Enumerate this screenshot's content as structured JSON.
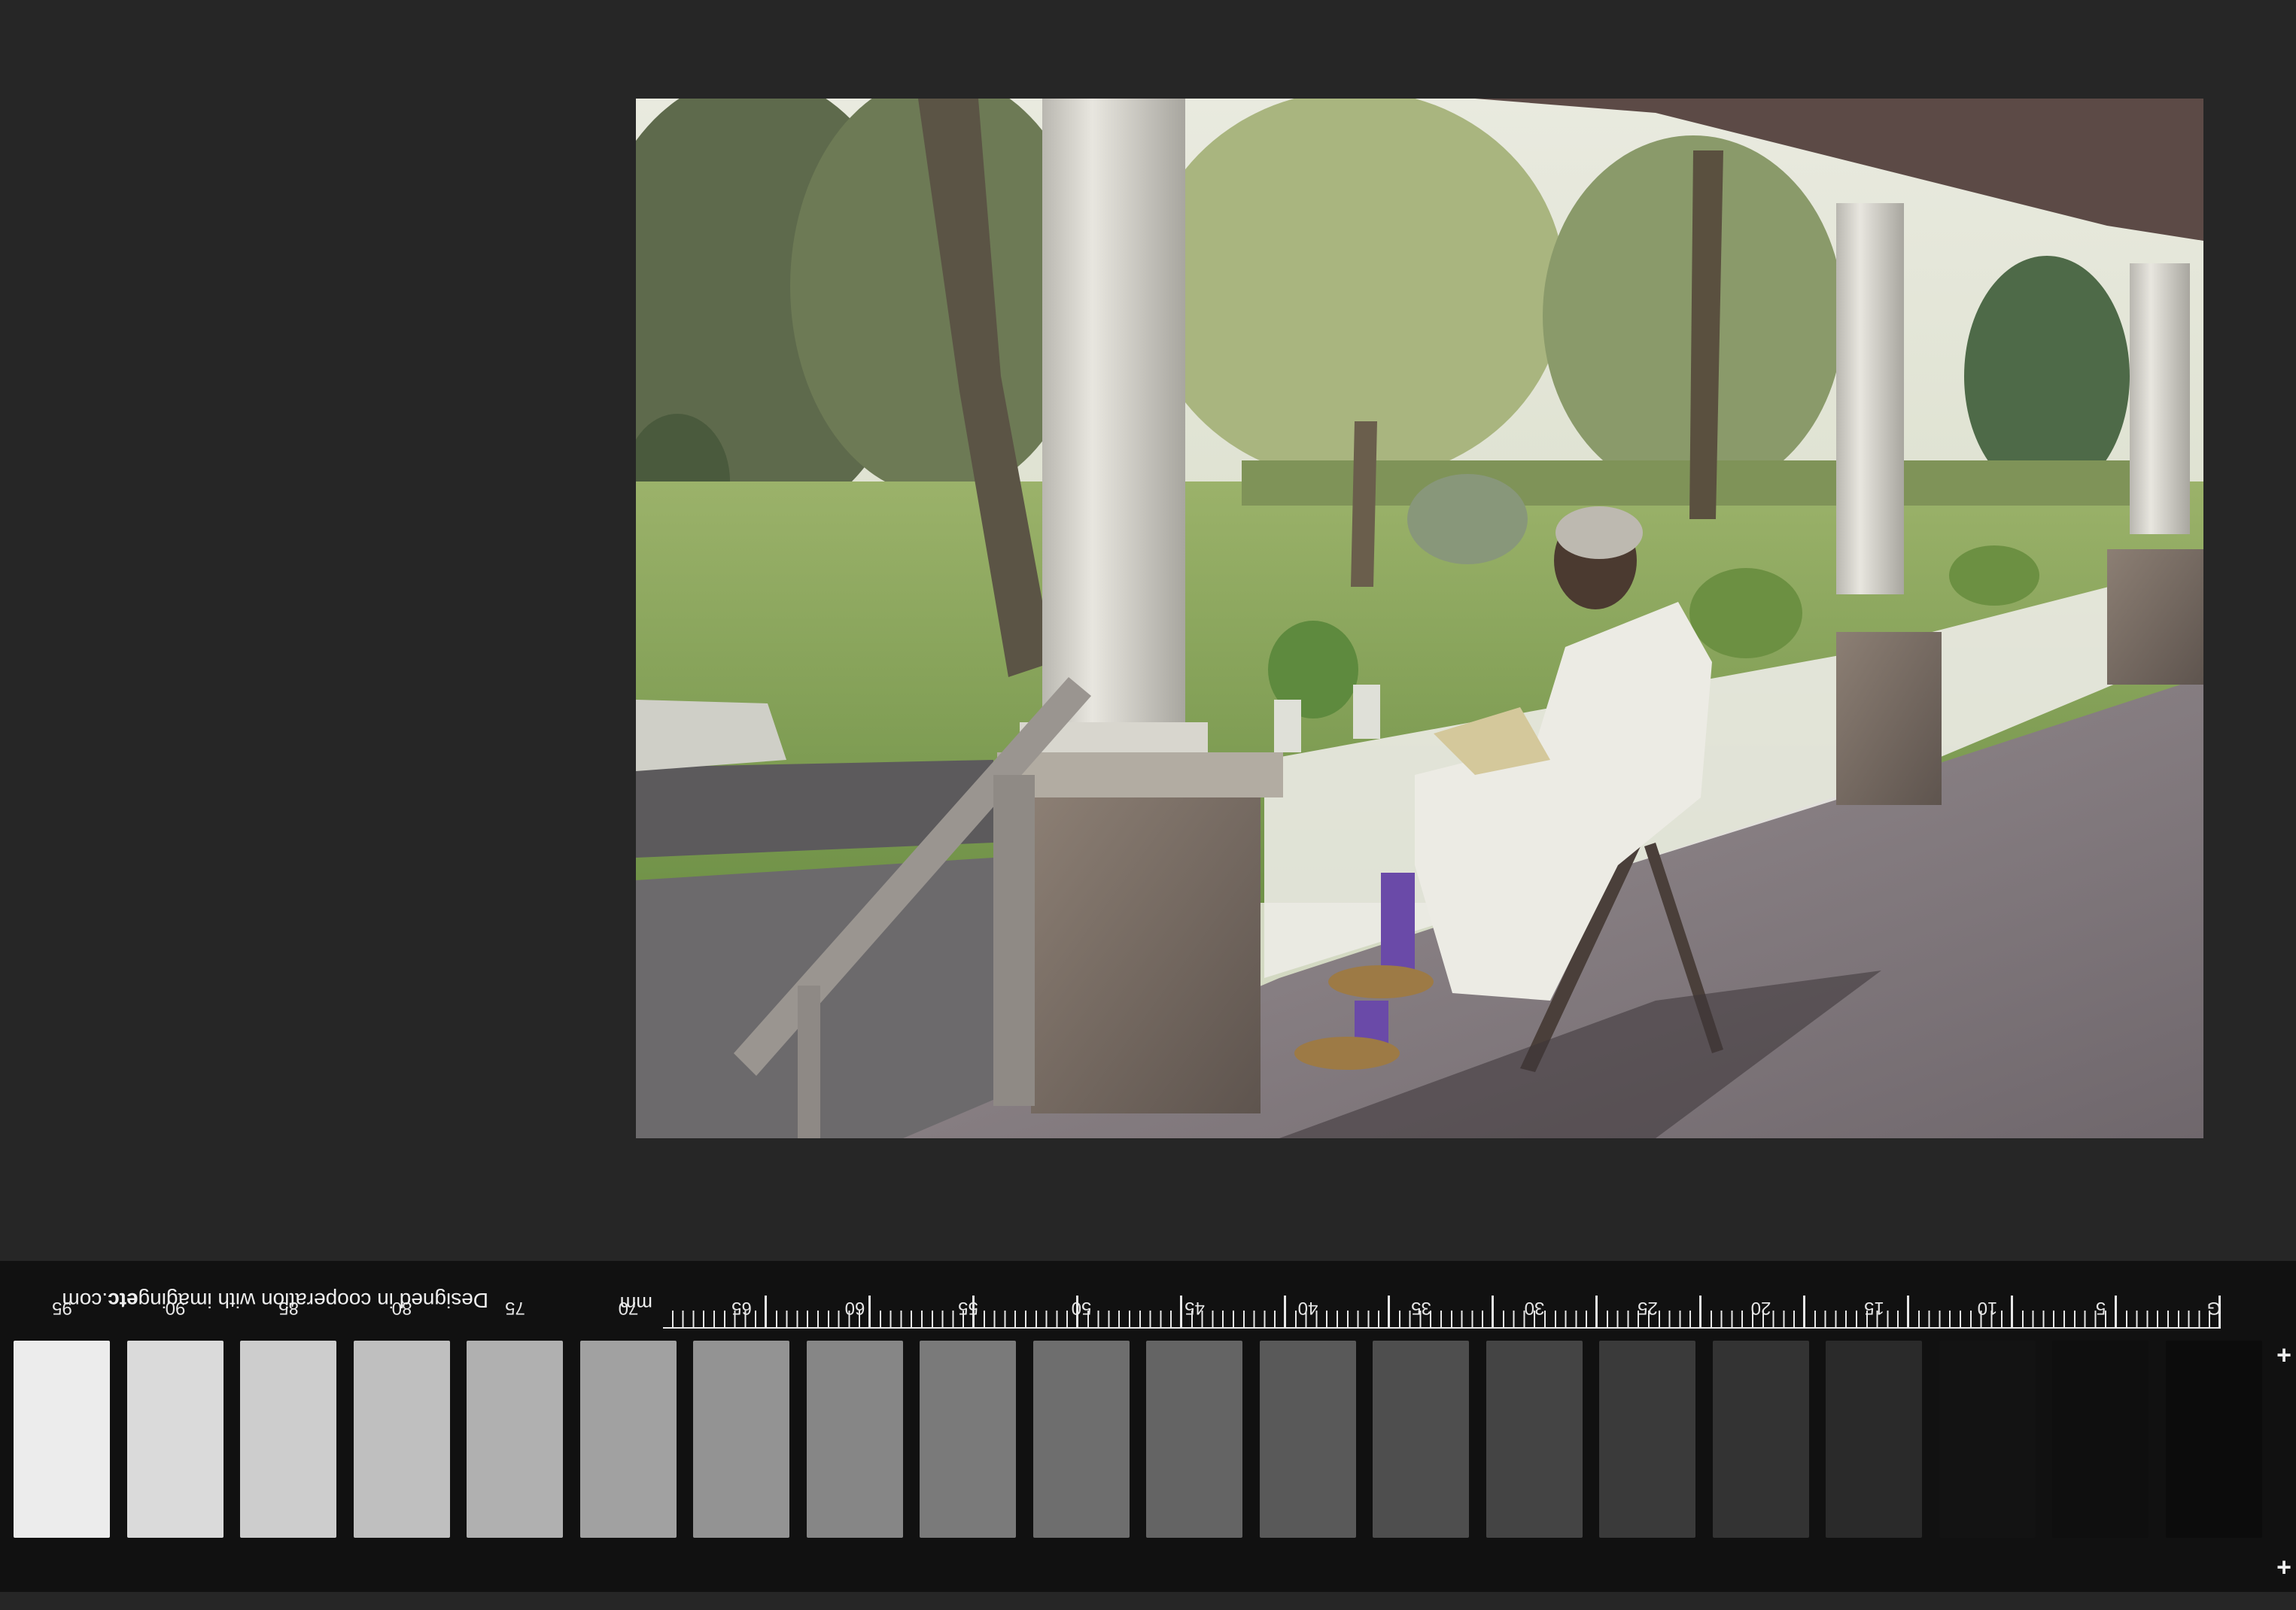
{
  "target": {
    "ruler_unit": "mm",
    "credit_prefix": "Designed in cooperation with imaging",
    "credit_bold": "etc",
    "credit_suffix": ".com",
    "patch_labels": [
      "G",
      "5",
      "10",
      "15",
      "20",
      "25",
      "30",
      "35",
      "40",
      "45",
      "50",
      "55",
      "60",
      "65",
      "70",
      "75",
      "80",
      "85",
      "90",
      "95"
    ],
    "patch_colors": [
      "#0c0c0c",
      "#0f0f0f",
      "#131313",
      "#2a2a2a",
      "#333333",
      "#3a3a3a",
      "#444444",
      "#4e4e4e",
      "#595959",
      "#646464",
      "#6e6e6e",
      "#7a7a7a",
      "#868686",
      "#939393",
      "#a1a1a1",
      "#b0b0b0",
      "#bfbfbf",
      "#cdcdcd",
      "#dadada",
      "#ececec"
    ],
    "plus_marks": [
      "+",
      "+"
    ]
  },
  "colors": {
    "mat": "#262626",
    "print_border": "#f4f1ea"
  }
}
